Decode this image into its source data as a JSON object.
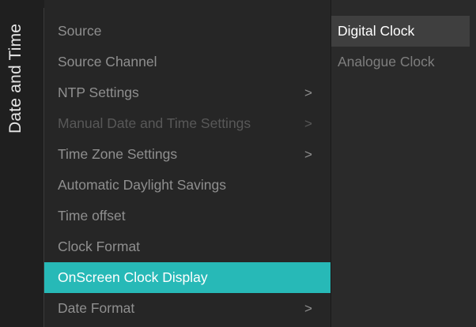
{
  "panel_title": "Date and Time",
  "menu": {
    "items": [
      {
        "label": "Source",
        "has_submenu": false,
        "disabled": false,
        "selected": false
      },
      {
        "label": "Source Channel",
        "has_submenu": false,
        "disabled": false,
        "selected": false
      },
      {
        "label": "NTP Settings",
        "has_submenu": true,
        "disabled": false,
        "selected": false
      },
      {
        "label": "Manual Date and Time Settings",
        "has_submenu": true,
        "disabled": true,
        "selected": false
      },
      {
        "label": "Time Zone Settings",
        "has_submenu": true,
        "disabled": false,
        "selected": false
      },
      {
        "label": "Automatic Daylight Savings",
        "has_submenu": false,
        "disabled": false,
        "selected": false
      },
      {
        "label": "Time offset",
        "has_submenu": false,
        "disabled": false,
        "selected": false
      },
      {
        "label": "Clock Format",
        "has_submenu": false,
        "disabled": false,
        "selected": false
      },
      {
        "label": "OnScreen Clock Display",
        "has_submenu": false,
        "disabled": false,
        "selected": true
      },
      {
        "label": "Date Format",
        "has_submenu": true,
        "disabled": false,
        "selected": false
      }
    ],
    "chevron_glyph": ">"
  },
  "options": {
    "items": [
      {
        "label": "Digital Clock",
        "focused": true
      },
      {
        "label": "Analogue Clock",
        "focused": false
      }
    ]
  },
  "colors": {
    "accent": "#27b9b7",
    "background": "#1f1f1f",
    "menu_panel": "#262626",
    "option_panel": "#2a2a2a",
    "text_normal": "#8f8f8f",
    "text_disabled": "#585858",
    "text_active": "#ffffff"
  },
  "icons": {
    "submenu_indicator": "chevron-right-icon"
  }
}
